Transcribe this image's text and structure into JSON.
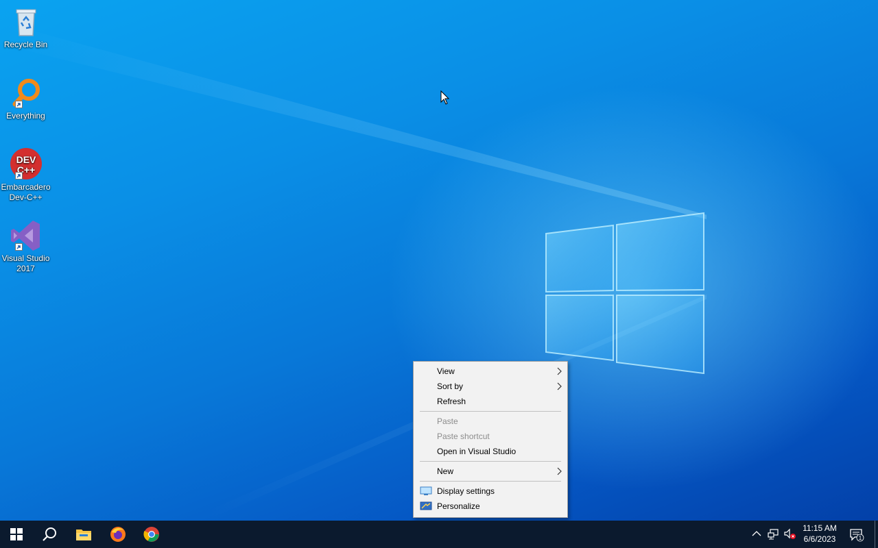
{
  "desktop": {
    "icons": [
      {
        "label": "Recycle Bin",
        "icon": "recycle-bin-icon"
      },
      {
        "label": "Everything",
        "icon": "everything-search-icon"
      },
      {
        "label": "Embarcadero\nDev-C++",
        "label_line1": "Embarcadero",
        "label_line2": "Dev-C++",
        "icon": "dev-cpp-icon",
        "icon_text_top": "DEV",
        "icon_text_bottom": "C++"
      },
      {
        "label": "Visual Studio\n2017",
        "label_line1": "Visual Studio",
        "label_line2": "2017",
        "icon": "visual-studio-icon"
      }
    ]
  },
  "context_menu": {
    "items": [
      {
        "label": "View",
        "submenu": true,
        "disabled": false
      },
      {
        "label": "Sort by",
        "submenu": true,
        "disabled": false
      },
      {
        "label": "Refresh",
        "submenu": false,
        "disabled": false
      },
      {
        "label": "Paste",
        "submenu": false,
        "disabled": true
      },
      {
        "label": "Paste shortcut",
        "submenu": false,
        "disabled": true
      },
      {
        "label": "Open in Visual Studio",
        "submenu": false,
        "disabled": false
      },
      {
        "label": "New",
        "submenu": true,
        "disabled": false
      },
      {
        "label": "Display settings",
        "submenu": false,
        "disabled": false,
        "icon": "display-settings-icon"
      },
      {
        "label": "Personalize",
        "submenu": false,
        "disabled": false,
        "icon": "personalize-icon"
      }
    ]
  },
  "taskbar": {
    "pinned": [
      "start-icon",
      "search-icon",
      "file-explorer-icon",
      "firefox-icon",
      "chrome-icon"
    ],
    "tray_icons": [
      "chevron-up-icon",
      "network-icon",
      "volume-muted-icon"
    ],
    "clock": {
      "time": "11:15 AM",
      "date": "6/6/2023"
    },
    "notifications_count": "1"
  },
  "colors": {
    "taskbar": "#0b1a2e",
    "menu_bg": "#f2f2f2",
    "desktop_accent": "#0a8fe6"
  }
}
